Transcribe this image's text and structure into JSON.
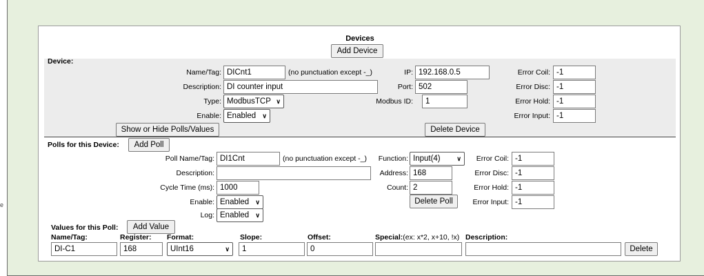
{
  "header": {
    "title": "Devices",
    "add_device": "Add Device"
  },
  "device": {
    "section_label": "Device:",
    "name_label": "Name/Tag:",
    "name_value": "DICnt1",
    "name_hint": "(no punctuation except -_)",
    "desc_label": "Description:",
    "desc_value": "DI counter input",
    "type_label": "Type:",
    "type_value": "ModbusTCP",
    "enable_label": "Enable:",
    "enable_value": "Enabled",
    "ip_label": "IP:",
    "ip_value": "192.168.0.5",
    "port_label": "Port:",
    "port_value": "502",
    "modbus_id_label": "Modbus ID:",
    "modbus_id_value": "1",
    "err_coil_label": "Error Coil:",
    "err_coil_value": "-1",
    "err_disc_label": "Error Disc:",
    "err_disc_value": "-1",
    "err_hold_label": "Error Hold:",
    "err_hold_value": "-1",
    "err_input_label": "Error Input:",
    "err_input_value": "-1",
    "show_hide": "Show or Hide Polls/Values",
    "delete": "Delete Device"
  },
  "polls": {
    "section_label": "Polls for this Device:",
    "add_poll": "Add Poll",
    "name_label": "Poll Name/Tag:",
    "name_value": "DI1Cnt",
    "name_hint": "(no punctuation except -_)",
    "desc_label": "Description:",
    "desc_value": "",
    "cycle_label": "Cycle Time (ms):",
    "cycle_value": "1000",
    "enable_label": "Enable:",
    "enable_value": "Enabled",
    "log_label": "Log:",
    "log_value": "Enabled",
    "function_label": "Function:",
    "function_value": "Input(4)",
    "address_label": "Address:",
    "address_value": "168",
    "count_label": "Count:",
    "count_value": "2",
    "delete_poll": "Delete Poll",
    "err_coil_label": "Error Coil:",
    "err_coil_value": "-1",
    "err_disc_label": "Error Disc:",
    "err_disc_value": "-1",
    "err_hold_label": "Error Hold:",
    "err_hold_value": "-1",
    "err_input_label": "Error Input:",
    "err_input_value": "-1"
  },
  "values": {
    "section_label": "Values for this Poll:",
    "add_value": "Add Value",
    "columns": {
      "name": "Name/Tag:",
      "register": "Register:",
      "format": "Format:",
      "slope": "Slope:",
      "offset": "Offset:",
      "special": "Special:",
      "special_hint": "(ex: x*2, x+10, !x)",
      "description": "Description:"
    },
    "rows": [
      {
        "name": "DI-C1",
        "register": "168",
        "format": "UInt16",
        "slope": "1",
        "offset": "0",
        "special": "",
        "description": "",
        "delete": "Delete"
      }
    ]
  },
  "edge_marker": "e"
}
